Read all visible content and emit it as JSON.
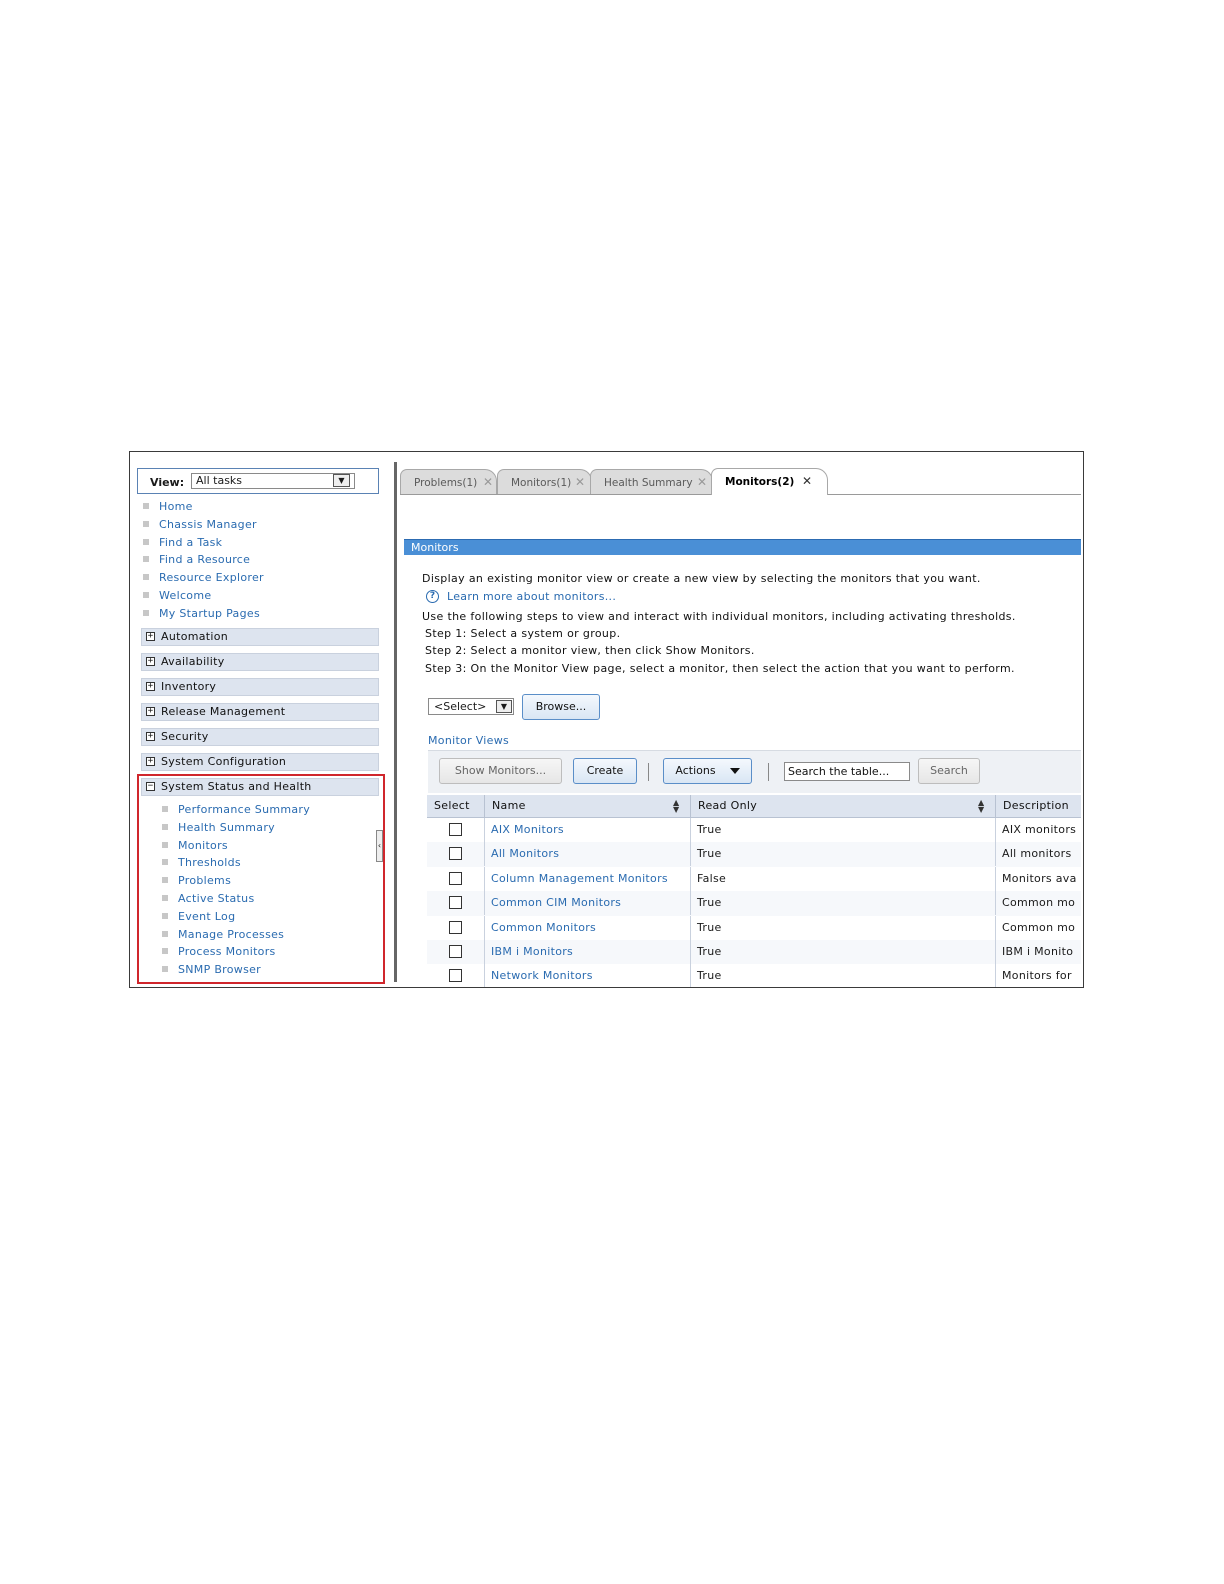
{
  "nav": {
    "view_label": "View:",
    "view_value": "All tasks",
    "links": [
      "Home",
      "Chassis Manager",
      "Find a Task",
      "Find a Resource",
      "Resource Explorer",
      "Welcome",
      "My Startup Pages"
    ],
    "categories": [
      {
        "sign": "+",
        "label": "Automation"
      },
      {
        "sign": "+",
        "label": "Availability"
      },
      {
        "sign": "+",
        "label": "Inventory"
      },
      {
        "sign": "+",
        "label": "Release Management"
      },
      {
        "sign": "+",
        "label": "Security"
      },
      {
        "sign": "+",
        "label": "System Configuration"
      },
      {
        "sign": "−",
        "label": "System Status and Health"
      }
    ],
    "sub_links": [
      "Performance Summary",
      "Health Summary",
      "Monitors",
      "Thresholds",
      "Problems",
      "Active Status",
      "Event Log",
      "Manage Processes",
      "Process Monitors",
      "SNMP Browser"
    ]
  },
  "tabs": [
    {
      "label": "Problems(1)",
      "close": "✕"
    },
    {
      "label": "Monitors(1)",
      "close": "✕"
    },
    {
      "label": "Health Summary",
      "close": "✕"
    },
    {
      "label": "Monitors(2)",
      "close": "✕"
    }
  ],
  "section": {
    "title": "Monitors",
    "intro": "Display an existing monitor view or create a new view by selecting the monitors that you want.",
    "help_icon": "?",
    "help_link": "Learn more about monitors...",
    "steps_intro": "Use the following steps to view and interact with individual monitors, including activating thresholds.",
    "step1": "Step 1: Select a system or group.",
    "step2": "Step 2: Select a monitor view, then click Show Monitors.",
    "step3": "Step 3: On the Monitor View page, select a monitor, then select the action that you want to perform."
  },
  "selector": {
    "value": "<Select>",
    "browse": "Browse..."
  },
  "monitor_views": {
    "label": "Monitor Views",
    "toolbar": {
      "show_monitors": "Show Monitors...",
      "create": "Create",
      "actions": "Actions",
      "search_placeholder": "Search the table...",
      "search": "Search"
    },
    "columns": [
      "Select",
      "Name",
      "Read Only",
      "Description"
    ],
    "rows": [
      {
        "name": "AIX Monitors",
        "read_only": "True",
        "description": "AIX monitors"
      },
      {
        "name": "All Monitors",
        "read_only": "True",
        "description": "All monitors"
      },
      {
        "name": "Column Management Monitors",
        "read_only": "False",
        "description": "Monitors ava"
      },
      {
        "name": "Common CIM Monitors",
        "read_only": "True",
        "description": "Common mo"
      },
      {
        "name": "Common Monitors",
        "read_only": "True",
        "description": "Common mo"
      },
      {
        "name": "IBM i Monitors",
        "read_only": "True",
        "description": "IBM i Monito"
      },
      {
        "name": "Network Monitors",
        "read_only": "True",
        "description": "Monitors for"
      }
    ]
  },
  "colors": {
    "link": "#2a6bb0",
    "section_bar": "#4a8fd6",
    "highlight_frame": "#d0262c",
    "category_bg": "#dde4ef"
  }
}
